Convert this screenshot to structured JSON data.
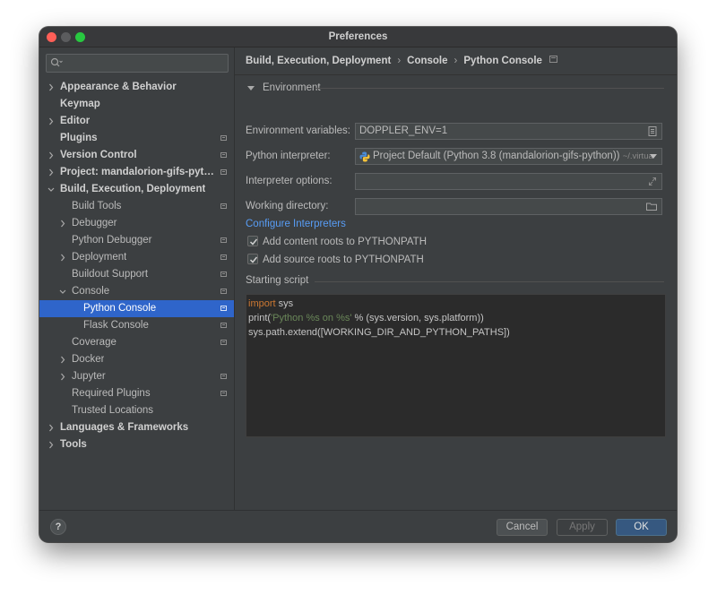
{
  "window": {
    "title": "Preferences"
  },
  "search": {
    "placeholder": ""
  },
  "sidebar": {
    "items": [
      {
        "label": "Appearance & Behavior",
        "level": 0,
        "expander": "collapsed",
        "bold": true,
        "project_icon": false,
        "selected": false,
        "icon": "chevron-right-icon"
      },
      {
        "label": "Keymap",
        "level": 0,
        "expander": "none",
        "bold": true,
        "project_icon": false,
        "selected": false
      },
      {
        "label": "Editor",
        "level": 0,
        "expander": "collapsed",
        "bold": true,
        "project_icon": false,
        "selected": false
      },
      {
        "label": "Plugins",
        "level": 0,
        "expander": "none",
        "bold": true,
        "project_icon": true,
        "selected": false
      },
      {
        "label": "Version Control",
        "level": 0,
        "expander": "collapsed",
        "bold": true,
        "project_icon": true,
        "selected": false
      },
      {
        "label": "Project: mandalorion-gifs-pyth...",
        "level": 0,
        "expander": "collapsed",
        "bold": true,
        "project_icon": true,
        "selected": false
      },
      {
        "label": "Build, Execution, Deployment",
        "level": 0,
        "expander": "expanded",
        "bold": true,
        "project_icon": false,
        "selected": false
      },
      {
        "label": "Build Tools",
        "level": 1,
        "expander": "none",
        "bold": false,
        "project_icon": true,
        "selected": false
      },
      {
        "label": "Debugger",
        "level": 1,
        "expander": "collapsed",
        "bold": false,
        "project_icon": false,
        "selected": false
      },
      {
        "label": "Python Debugger",
        "level": 1,
        "expander": "none",
        "bold": false,
        "project_icon": true,
        "selected": false
      },
      {
        "label": "Deployment",
        "level": 1,
        "expander": "collapsed",
        "bold": false,
        "project_icon": true,
        "selected": false
      },
      {
        "label": "Buildout Support",
        "level": 1,
        "expander": "none",
        "bold": false,
        "project_icon": true,
        "selected": false
      },
      {
        "label": "Console",
        "level": 1,
        "expander": "expanded",
        "bold": false,
        "project_icon": true,
        "selected": false
      },
      {
        "label": "Python Console",
        "level": 2,
        "expander": "none",
        "bold": false,
        "project_icon": true,
        "selected": true
      },
      {
        "label": "Flask Console",
        "level": 2,
        "expander": "none",
        "bold": false,
        "project_icon": true,
        "selected": false
      },
      {
        "label": "Coverage",
        "level": 1,
        "expander": "none",
        "bold": false,
        "project_icon": true,
        "selected": false
      },
      {
        "label": "Docker",
        "level": 1,
        "expander": "collapsed",
        "bold": false,
        "project_icon": false,
        "selected": false
      },
      {
        "label": "Jupyter",
        "level": 1,
        "expander": "collapsed",
        "bold": false,
        "project_icon": true,
        "selected": false
      },
      {
        "label": "Required Plugins",
        "level": 1,
        "expander": "none",
        "bold": false,
        "project_icon": true,
        "selected": false
      },
      {
        "label": "Trusted Locations",
        "level": 1,
        "expander": "none",
        "bold": false,
        "project_icon": false,
        "selected": false
      },
      {
        "label": "Languages & Frameworks",
        "level": 0,
        "expander": "collapsed",
        "bold": true,
        "project_icon": false,
        "selected": false
      },
      {
        "label": "Tools",
        "level": 0,
        "expander": "collapsed",
        "bold": true,
        "project_icon": false,
        "selected": false
      }
    ]
  },
  "breadcrumb": {
    "parts": [
      "Build, Execution, Deployment",
      "Console",
      "Python Console"
    ]
  },
  "environment": {
    "section_label": "Environment",
    "env_vars_label": "Environment variables:",
    "env_vars_value": "DOPPLER_ENV=1",
    "interpreter_label": "Python interpreter:",
    "interpreter_value": "Project Default (Python 3.8 (mandalorion-gifs-python))",
    "interpreter_hint": "~/.virtua",
    "interpreter_options_label": "Interpreter options:",
    "interpreter_options_value": "",
    "working_dir_label": "Working directory:",
    "working_dir_value": "",
    "configure_link": "Configure Interpreters",
    "add_content_roots": {
      "label": "Add content roots to PYTHONPATH",
      "checked": true
    },
    "add_source_roots": {
      "label": "Add source roots to PYTHONPATH",
      "checked": true
    }
  },
  "starting_script": {
    "label": "Starting script",
    "lines": [
      {
        "k": "import",
        "rest": " sys"
      },
      {
        "pre": "print(",
        "s": "'Python %s on %s'",
        "post": " % (sys.version, sys.platform))"
      },
      {
        "plain": "sys.path.extend([WORKING_DIR_AND_PYTHON_PATHS])"
      }
    ]
  },
  "footer": {
    "help_label": "?",
    "cancel_label": "Cancel",
    "apply_label": "Apply",
    "ok_label": "OK"
  },
  "colors": {
    "selection": "#2f65ca",
    "link": "#589df6",
    "keyword": "#cc7832",
    "string": "#6a8759",
    "ok_button": "#365880"
  }
}
